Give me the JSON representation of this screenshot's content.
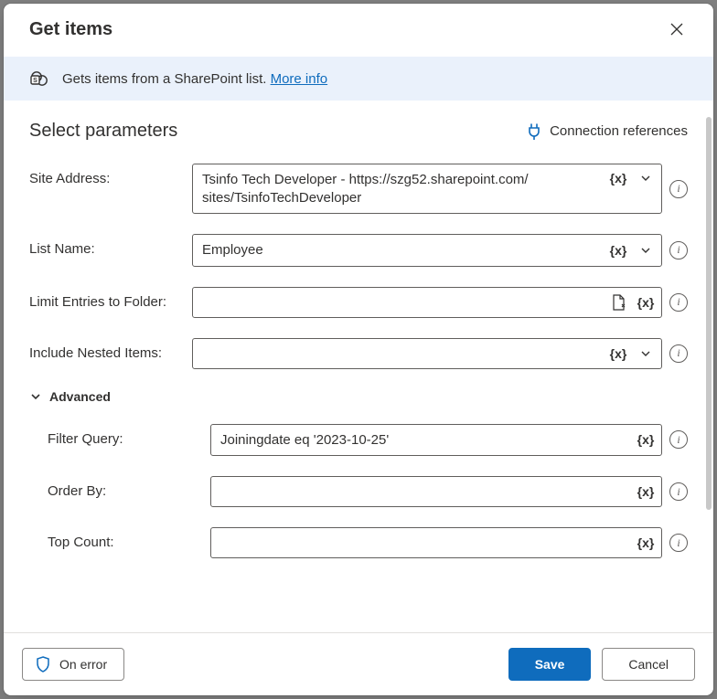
{
  "header": {
    "title": "Get items"
  },
  "info": {
    "text": "Gets items from a SharePoint list. ",
    "link_label": "More info"
  },
  "section": {
    "title": "Select parameters"
  },
  "connection": {
    "label": "Connection references"
  },
  "tokens": {
    "fx": "{x}"
  },
  "params": {
    "site_address": {
      "label": "Site Address:",
      "value": "Tsinfo Tech Developer - https://szg52.sharepoint.com/\nsites/TsinfoTechDeveloper"
    },
    "list_name": {
      "label": "List Name:",
      "value": "Employee"
    },
    "limit_folder": {
      "label": "Limit Entries to Folder:",
      "value": ""
    },
    "include_nested": {
      "label": "Include Nested Items:",
      "value": ""
    }
  },
  "advanced": {
    "label": "Advanced",
    "filter_query": {
      "label": "Filter Query:",
      "value": "Joiningdate eq '2023-10-25'"
    },
    "order_by": {
      "label": "Order By:",
      "value": ""
    },
    "top_count": {
      "label": "Top Count:",
      "value": ""
    }
  },
  "footer": {
    "on_error": "On error",
    "save": "Save",
    "cancel": "Cancel"
  }
}
